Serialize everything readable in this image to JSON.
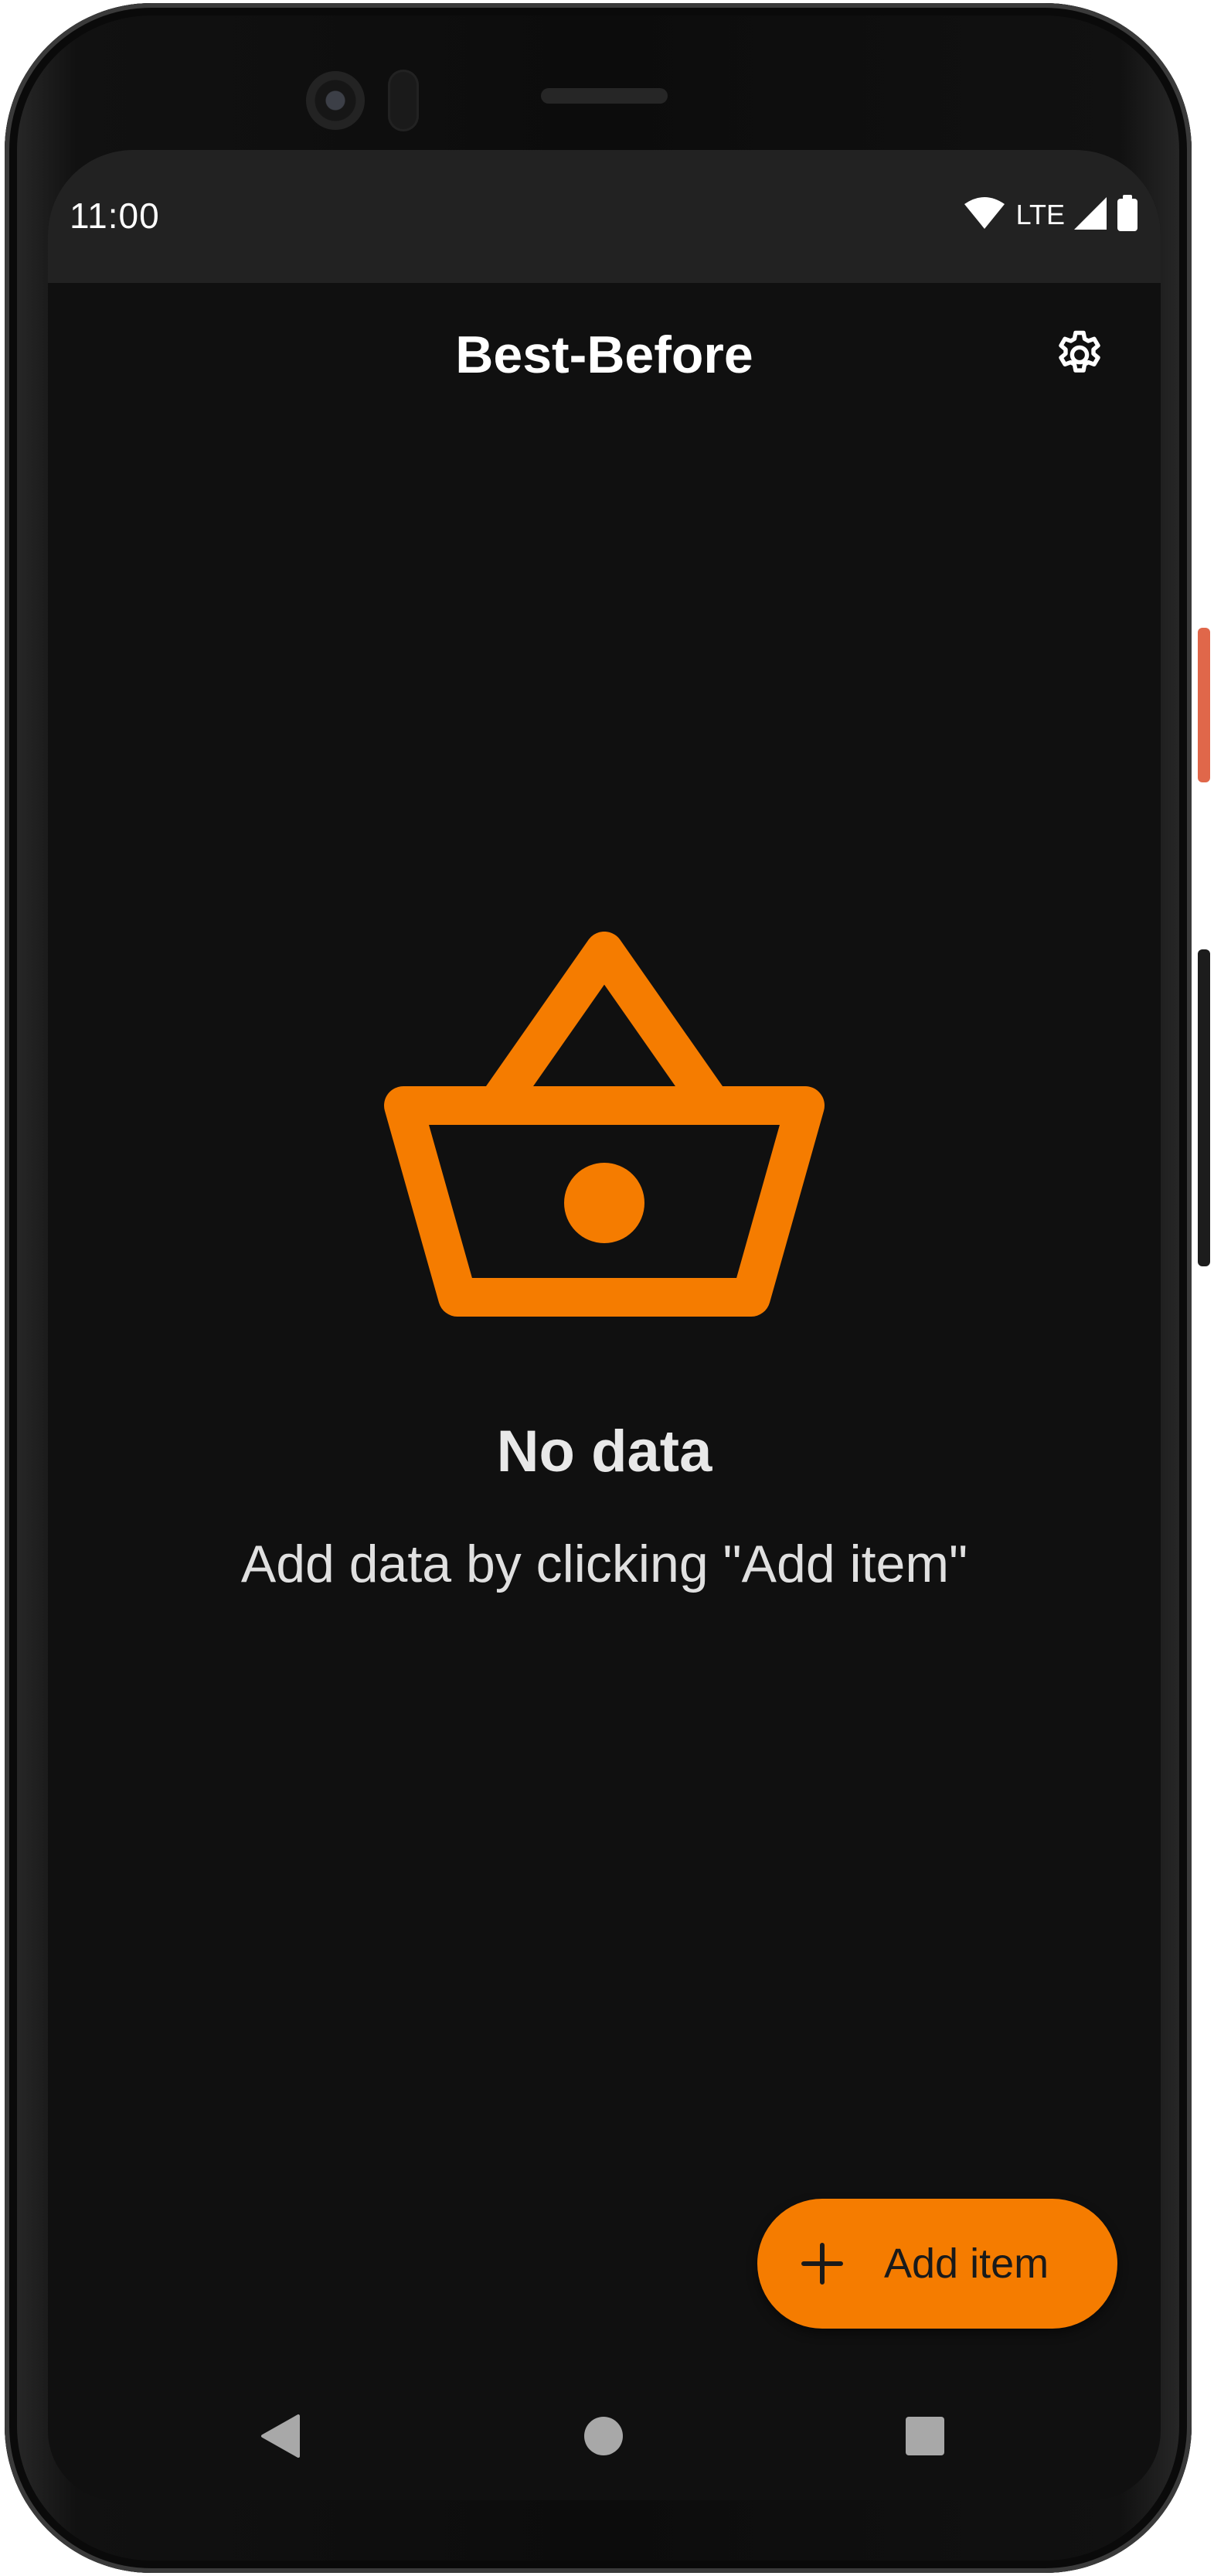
{
  "status_bar": {
    "time": "11:00",
    "network": "LTE",
    "icons": [
      "wifi-icon",
      "cell-signal-icon",
      "battery-icon"
    ]
  },
  "app_bar": {
    "title": "Best-Before",
    "actions": [
      "gear-icon"
    ]
  },
  "empty_state": {
    "icon": "shopping-basket-icon",
    "title": "No data",
    "subtitle": "Add data by clicking \"Add item\""
  },
  "fab": {
    "icon": "plus-icon",
    "label": "Add item"
  },
  "nav_bar": {
    "buttons": [
      "back-icon",
      "home-icon",
      "recents-icon"
    ]
  },
  "colors": {
    "accent": "#f57c00",
    "background": "#101010",
    "status_bar": "#222222",
    "text": "#ffffff"
  }
}
